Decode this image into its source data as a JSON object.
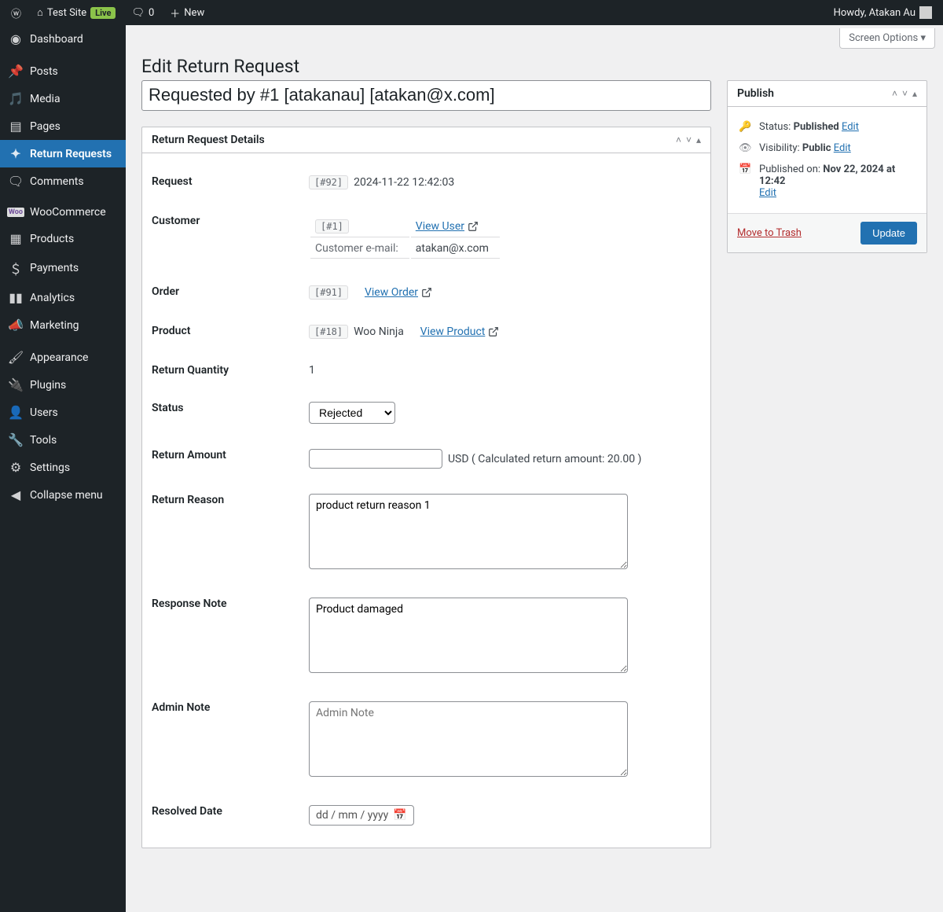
{
  "adminbar": {
    "site_name": "Test Site",
    "live_label": "Live",
    "comments_count": "0",
    "new_label": "New",
    "howdy": "Howdy, Atakan Au"
  },
  "sidebar": {
    "dashboard": "Dashboard",
    "posts": "Posts",
    "media": "Media",
    "pages": "Pages",
    "return_requests": "Return Requests",
    "comments": "Comments",
    "woocommerce": "WooCommerce",
    "products": "Products",
    "payments": "Payments",
    "analytics": "Analytics",
    "marketing": "Marketing",
    "appearance": "Appearance",
    "plugins": "Plugins",
    "users": "Users",
    "tools": "Tools",
    "settings": "Settings",
    "collapse": "Collapse menu"
  },
  "screen_options_label": "Screen Options ▾",
  "page_title": "Edit Return Request",
  "title_value": "Requested by #1 [atakanau] [atakan@x.com]",
  "details": {
    "box_title": "Return Request Details",
    "labels": {
      "request": "Request",
      "customer": "Customer",
      "order": "Order",
      "product": "Product",
      "return_qty": "Return Quantity",
      "status": "Status",
      "return_amount": "Return Amount",
      "return_reason": "Return Reason",
      "response_note": "Response Note",
      "admin_note": "Admin Note",
      "resolved_date": "Resolved Date"
    },
    "request_id": "[#92]",
    "request_date": "2024-11-22 12:42:03",
    "customer_id": "[#1]",
    "view_user_label": "View User",
    "customer_email_label": "Customer e-mail:",
    "customer_email": "atakan@x.com",
    "order_id": "[#91]",
    "view_order_label": "View Order",
    "product_id": "[#18]",
    "product_name": "Woo Ninja",
    "view_product_label": "View Product",
    "return_qty_value": "1",
    "status_value": "Rejected",
    "amount_currency": "USD",
    "amount_hint": "( Calculated return amount: 20.00 )",
    "return_reason_value": "product return reason 1",
    "response_note_value": "Product damaged",
    "admin_note_placeholder": "Admin Note",
    "date_placeholder": "dd / mm / yyyy"
  },
  "publish": {
    "box_title": "Publish",
    "status_label": "Status:",
    "status_value": "Published",
    "edit_label": "Edit",
    "visibility_label": "Visibility:",
    "visibility_value": "Public",
    "published_label": "Published on:",
    "published_value": "Nov 22, 2024 at 12:42",
    "trash_label": "Move to Trash",
    "update_label": "Update"
  }
}
